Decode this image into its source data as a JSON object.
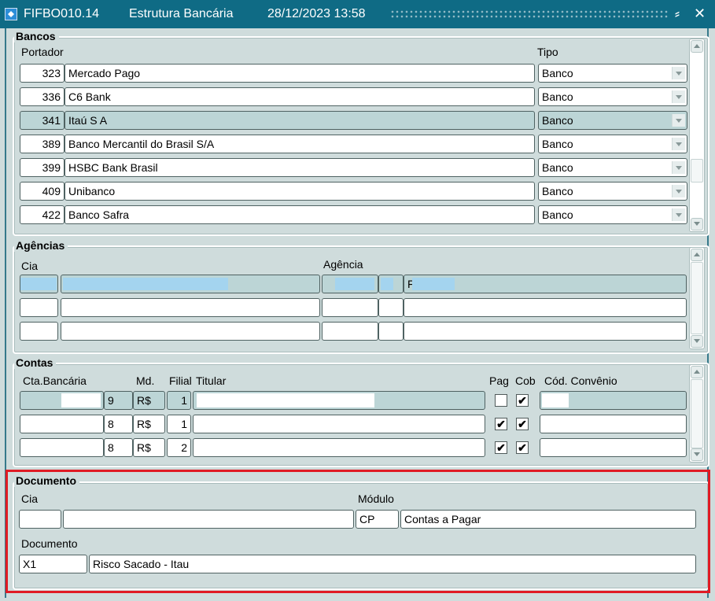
{
  "window": {
    "form_code": "FIFBO010.14",
    "form_title": "Estrutura Bancária",
    "datetime": "28/12/2023 13:58",
    "minimize_glyph": "⸗",
    "close_glyph": "✕"
  },
  "bancos": {
    "title": "Bancos",
    "col_portador": "Portador",
    "col_tipo": "Tipo",
    "rows": [
      {
        "code": "323",
        "name": "Mercado Pago",
        "tipo": "Banco"
      },
      {
        "code": "336",
        "name": "C6 Bank",
        "tipo": "Banco"
      },
      {
        "code": "341",
        "name": "Itaú S A",
        "tipo": "Banco"
      },
      {
        "code": "389",
        "name": "Banco Mercantil do Brasil S/A",
        "tipo": "Banco"
      },
      {
        "code": "399",
        "name": "HSBC Bank Brasil",
        "tipo": "Banco"
      },
      {
        "code": "409",
        "name": "Unibanco",
        "tipo": "Banco"
      },
      {
        "code": "422",
        "name": "Banco Safra",
        "tipo": "Banco"
      }
    ],
    "selected_row": 2
  },
  "agencias": {
    "title": "Agências",
    "col_cia": "Cia",
    "col_agencia": "Agência",
    "row1_prefix": "F"
  },
  "contas": {
    "title": "Contas",
    "col_cta": "Cta.Bancária",
    "col_md": "Md.",
    "col_filial": "Filial",
    "col_titular": "Titular",
    "col_pag": "Pag",
    "col_cob": "Cob",
    "col_convenio": "Cód. Convênio",
    "rows": [
      {
        "dv": "9",
        "md": "R$",
        "filial": "1",
        "pag": false,
        "cob": true
      },
      {
        "dv": "8",
        "md": "R$",
        "filial": "1",
        "pag": true,
        "cob": true
      },
      {
        "dv": "8",
        "md": "R$",
        "filial": "2",
        "pag": true,
        "cob": true
      }
    ],
    "check_glyph": "✔"
  },
  "documento_group": {
    "title": "Documento",
    "lbl_cia": "Cia",
    "lbl_modulo": "Módulo",
    "modulo_code": "CP",
    "modulo_name": "Contas a Pagar",
    "lbl_documento": "Documento",
    "documento_code": "X1",
    "documento_name": "Risco Sacado - Itau"
  },
  "colors": {
    "titlebar": "#0f6b85",
    "background": "#cfdcdc",
    "selected_row": "#bcd5d6",
    "redaction": "#a4d4ef",
    "highlight_border": "#e01b24"
  }
}
